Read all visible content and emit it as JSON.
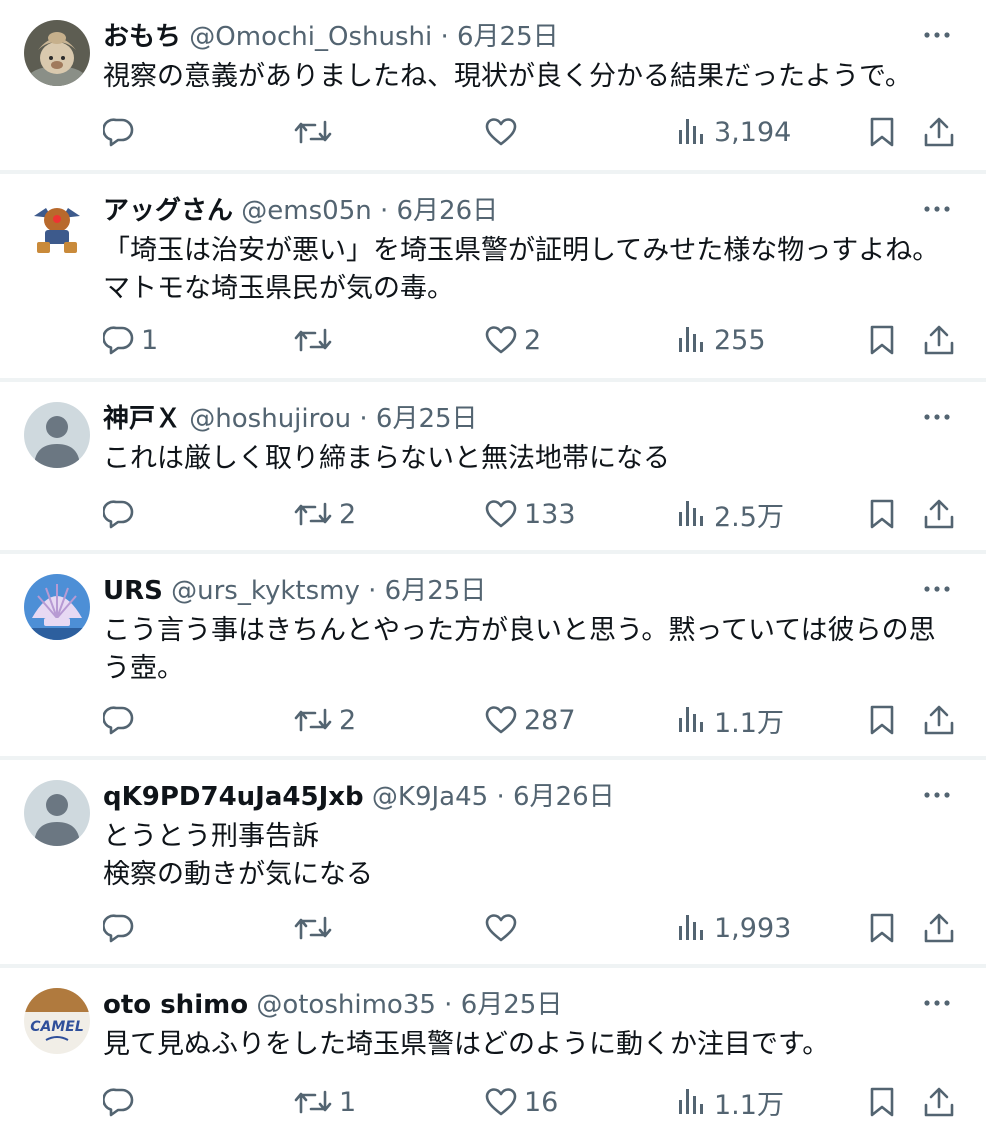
{
  "tweets": [
    {
      "name": "おもち",
      "handle": "@Omochi_Oshushi",
      "date": "6月25日",
      "lines": [
        "視察の意義がありましたね、現状が良く分かる結果だったようで。"
      ],
      "replies": "",
      "retweets": "",
      "likes": "",
      "views": "3,194",
      "avatar": "photo-plush"
    },
    {
      "name": "アッグさん",
      "handle": "@ems05n",
      "date": "6月26日",
      "lines": [
        "「埼玉は治安が悪い」を埼玉県警が証明してみせた様な物っすよね。",
        "マトモな埼玉県民が気の毒。"
      ],
      "replies": "1",
      "retweets": "",
      "likes": "2",
      "views": "255",
      "avatar": "robot-figure"
    },
    {
      "name": "神戸Ｘ",
      "handle": "@hoshujirou",
      "date": "6月25日",
      "lines": [
        "これは厳しく取り締まらないと無法地帯になる"
      ],
      "replies": "",
      "retweets": "2",
      "likes": "133",
      "views": "2.5万",
      "avatar": "default"
    },
    {
      "name": "URS",
      "handle": "@urs_kyktsmy",
      "date": "6月25日",
      "lines": [
        "こう言う事はきちんとやった方が良いと思う。黙っていては彼らの思",
        "う壺。"
      ],
      "replies": "",
      "retweets": "2",
      "likes": "287",
      "views": "1.1万",
      "avatar": "shell"
    },
    {
      "name": "qK9PD74uJa45Jxb",
      "handle": "@K9Ja45",
      "date": "6月26日",
      "lines": [
        "とうとう刑事告訴",
        "検察の動きが気になる"
      ],
      "replies": "",
      "retweets": "",
      "likes": "",
      "views": "1,993",
      "avatar": "default"
    },
    {
      "name": "oto shimo",
      "handle": "@otoshimo35",
      "date": "6月25日",
      "lines": [
        "見て見ぬふりをした埼玉県警はどのように動くか注目です。"
      ],
      "replies": "",
      "retweets": "1",
      "likes": "16",
      "views": "1.1万",
      "avatar": "camel-logo"
    }
  ],
  "separator_dot": "·",
  "camel_logo_text": "CAMEL",
  "colors": {
    "text": "#0f1419",
    "secondary": "#536471",
    "divider": "#eff3f4",
    "avatar_default": "#cfd9de"
  },
  "icons": [
    "more-icon",
    "reply-icon",
    "retweet-icon",
    "like-icon",
    "views-icon",
    "bookmark-icon",
    "share-icon"
  ]
}
